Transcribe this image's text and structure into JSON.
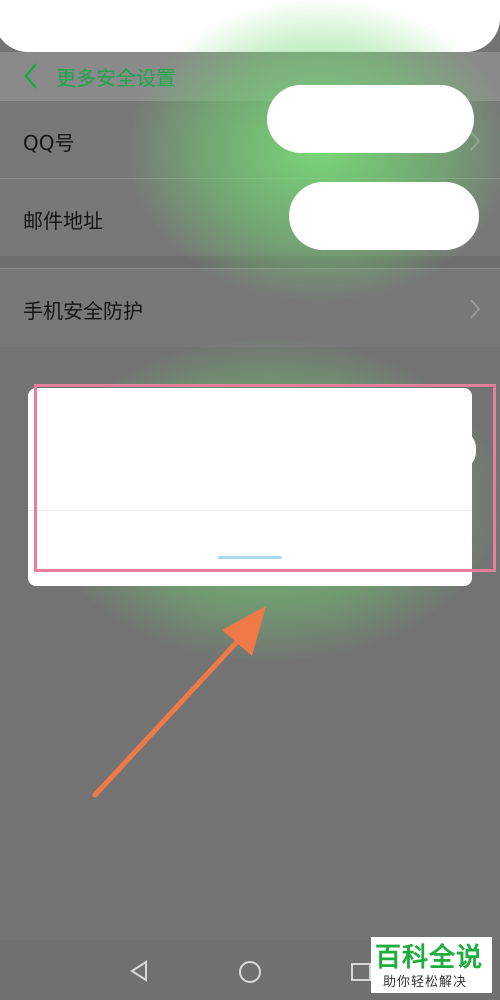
{
  "header": {
    "title": "更多安全设置"
  },
  "settings": {
    "items": [
      {
        "label": "QQ号"
      },
      {
        "label": "邮件地址"
      },
      {
        "label": "手机安全防护"
      }
    ]
  },
  "colors": {
    "accent_green": "#1aa64a",
    "highlight_pink": "#e97d9c",
    "arrow_orange": "#f07a47",
    "overlay_gray": "#737373"
  },
  "navbar": {
    "icons": [
      "back-icon",
      "home-icon",
      "recents-icon"
    ]
  },
  "watermark": {
    "title": "百科全说",
    "subtitle": "助你轻松解决"
  }
}
